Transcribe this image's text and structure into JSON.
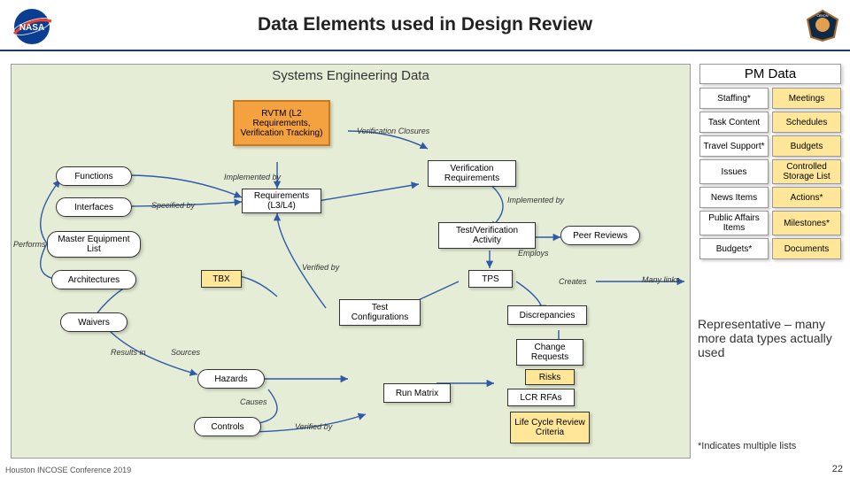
{
  "header": {
    "title": "Data Elements used in Design Review"
  },
  "se": {
    "title": "Systems Engineering Data"
  },
  "pm": {
    "title": "PM Data",
    "rows": [
      [
        "Staffing*",
        "Meetings"
      ],
      [
        "Task Content",
        "Schedules"
      ],
      [
        "Travel Support*",
        "Budgets"
      ],
      [
        "Issues",
        "Controlled Storage List"
      ],
      [
        "News Items",
        "Actions*"
      ],
      [
        "Public Affairs Items",
        "Milestones*"
      ],
      [
        "Budgets*",
        "Documents"
      ]
    ]
  },
  "nodes": {
    "rvtm": "RVTM (L2 Requirements, Verification Tracking)",
    "functions": "Functions",
    "interfaces": "Interfaces",
    "mel": "Master Equipment List",
    "architectures": "Architectures",
    "waivers": "Waivers",
    "tbx": "TBX",
    "requirements": "Requirements (L3/L4)",
    "ver_req": "Verification Requirements",
    "tva": "Test/Verification Activity",
    "peer": "Peer Reviews",
    "tps": "TPS",
    "testconfig": "Test Configurations",
    "discrep": "Discrepancies",
    "changereq": "Change Requests",
    "risks": "Risks",
    "runmatrix": "Run Matrix",
    "lcrrfa": "LCR RFAs",
    "lifecycle": "Life Cycle Review Criteria",
    "hazards": "Hazards",
    "controls": "Controls"
  },
  "labels": {
    "verif_closures": "Verification Closures",
    "implemented_by": "Implemented by",
    "implemented_by2": "Implemented by",
    "specified_by": "Specified by",
    "performs": "Performs",
    "verified_by": "Verified by",
    "verified_by2": "Verified by",
    "employs": "Employs",
    "creates": "Creates",
    "many_links": "Many links",
    "results_in": "Results in",
    "sources": "Sources",
    "causes": "Causes"
  },
  "notes": {
    "rep": "Representative – many more data types actually used",
    "ast": "*Indicates multiple lists"
  },
  "footer": "Houston INCOSE Conference 2019",
  "page": "22"
}
